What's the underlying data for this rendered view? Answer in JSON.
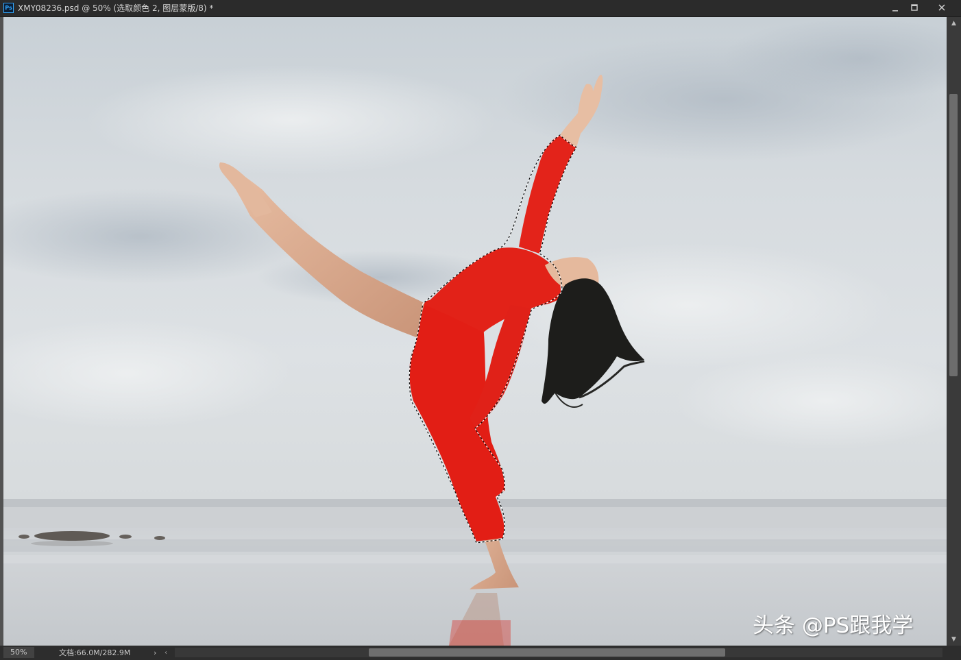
{
  "window": {
    "title": "XMY08236.psd @ 50% (选取颜色 2, 图层蒙版/8) *",
    "app_icon": "ps-app-icon",
    "app_icon_label": "Ps",
    "controls": {
      "minimize": "minimize-icon",
      "maximize": "maximize-icon",
      "close": "close-icon"
    }
  },
  "canvas": {
    "subject": "dancer-in-red-dress-on-beach",
    "selection_active": true,
    "colors": {
      "sky": "#d3d8dc",
      "dress": "#e41f16",
      "water": "#c9cdd1"
    }
  },
  "watermark": {
    "text": "头条 @PS跟我学"
  },
  "statusbar": {
    "zoom": "50%",
    "doc_info": "文档:66.0M/282.9M",
    "more_arrow": "›"
  },
  "scrollbars": {
    "vertical_up": "▲",
    "vertical_down": "▼",
    "horizontal_left": "‹"
  }
}
